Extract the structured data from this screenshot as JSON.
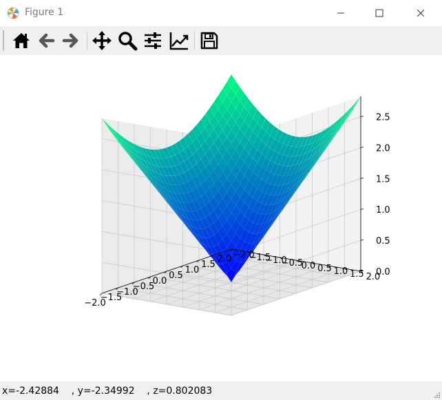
{
  "window": {
    "title": "Figure 1",
    "controls": [
      "minimize",
      "maximize",
      "close"
    ]
  },
  "toolbar": {
    "buttons": [
      {
        "name": "home",
        "icon": "home-icon"
      },
      {
        "name": "back",
        "icon": "arrow-left-icon"
      },
      {
        "name": "forward",
        "icon": "arrow-right-icon"
      },
      {
        "name": "pan",
        "icon": "move-icon"
      },
      {
        "name": "zoom",
        "icon": "magnifier-icon"
      },
      {
        "name": "configure-subplots",
        "icon": "sliders-icon"
      },
      {
        "name": "edit-axes",
        "icon": "line-chart-icon"
      },
      {
        "name": "save",
        "icon": "floppy-disk-icon"
      }
    ]
  },
  "status": {
    "text": "x=-2.42884    , y=-2.34992    , z=0.802083"
  },
  "chart_data": {
    "type": "surface3d",
    "function": "sqrt(x^2 + y^2)",
    "colormap": "winter",
    "colors": {
      "low": "#0000ff",
      "high": "#00ff80"
    },
    "grid": true,
    "x_range": [
      -2,
      2
    ],
    "y_range": [
      -2,
      2
    ],
    "zlim": [
      0,
      2.83
    ],
    "xticks": [
      "−2.0",
      "−1.5",
      "−1.0",
      "−0.5",
      "0.0",
      "0.5",
      "1.0",
      "1.5",
      "2.0"
    ],
    "yticks": [
      "−2.0",
      "−1.5",
      "−1.0",
      "−0.5",
      "0.0",
      "0.5",
      "1.0",
      "1.5",
      "2.0"
    ],
    "zticks": [
      "0.0",
      "0.5",
      "1.0",
      "1.5",
      "2.0",
      "2.5"
    ]
  }
}
